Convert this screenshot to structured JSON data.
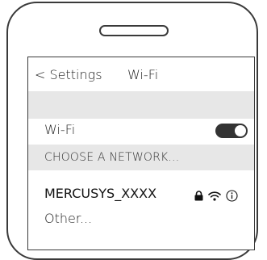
{
  "navbar": {
    "back_label": "< Settings",
    "title": "Wi-Fi"
  },
  "wifi_toggle": {
    "label": "Wi-Fi",
    "state": "on"
  },
  "networks_section": {
    "header": "CHOOSE A NETWORK...",
    "networks": [
      {
        "name": "MERCUSYS_XXXX",
        "secured": true,
        "icons": [
          "lock-icon",
          "wifi-signal-icon",
          "info-icon"
        ]
      }
    ],
    "other_label": "Other..."
  },
  "colors": {
    "frame": "#3a3a3a",
    "band": "#e7e7e7",
    "toggle_on": "#333333"
  }
}
